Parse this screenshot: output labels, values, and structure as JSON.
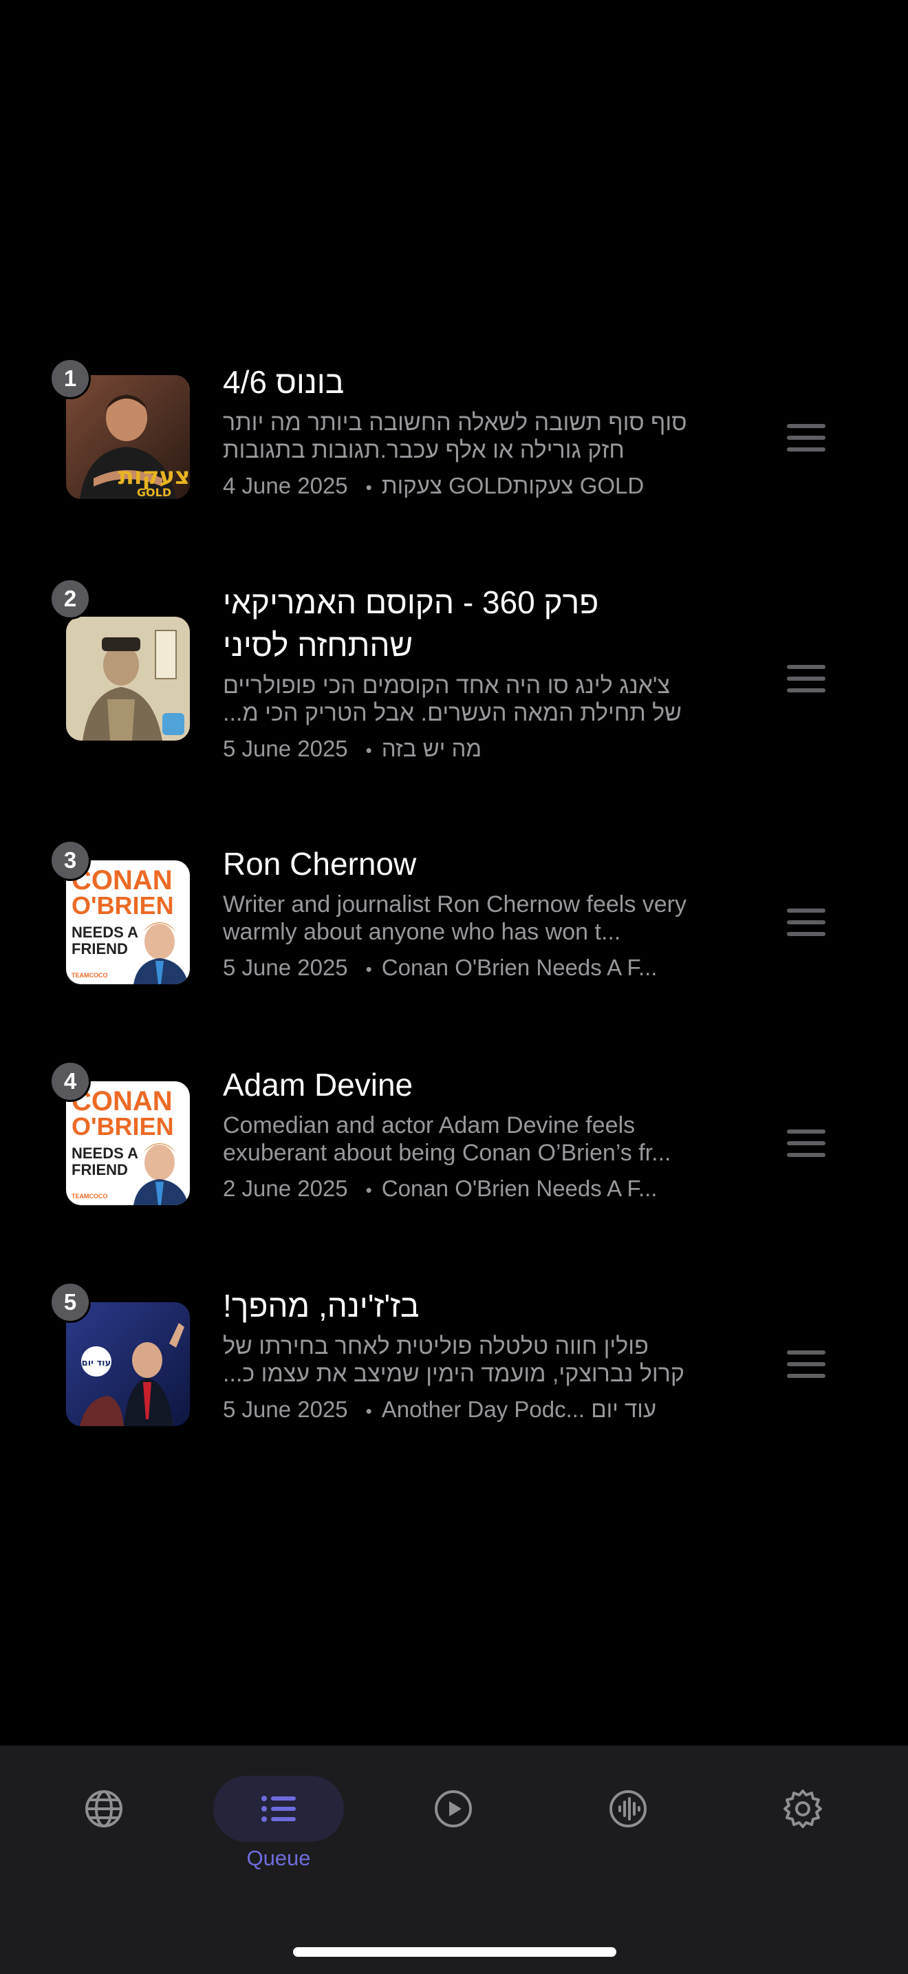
{
  "queue": {
    "items": [
      {
        "number": "1",
        "title": "בונוס 4/6",
        "description": "סוף סוף תשובה לשאלה החשובה ביותר מה יותר חזק גורילה או אלף עכבר.תגובות בתגובות",
        "date": "4 June 2025",
        "podcast": "צעקות GOLDצעקות GOLD",
        "artwork": "tzaakot-gold-artwork"
      },
      {
        "number": "2",
        "title": "פרק 360 - הקוסם האמריקאי שהתחזה לסיני",
        "description": "צ'אנג לינג סו היה אחד הקוסמים הכי פופולריים של תחילת המאה העשרים. אבל הטריק הכי מ...",
        "date": "5 June 2025",
        "podcast": "מה יש בזה",
        "artwork": "ma-yesh-baze-artwork"
      },
      {
        "number": "3",
        "title": "Ron Chernow",
        "description": "Writer and journalist Ron Chernow feels very warmly about anyone who has won t...",
        "date": "5 June 2025",
        "podcast": "Conan O'Brien Needs A F...",
        "artwork": "conan-artwork"
      },
      {
        "number": "4",
        "title": "Adam Devine",
        "description": "Comedian and actor Adam Devine feels exuberant about being Conan O’Brien’s fr...",
        "date": "2 June 2025",
        "podcast": "Conan O'Brien Needs A F...",
        "artwork": "conan-artwork"
      },
      {
        "number": "5",
        "title": "בז'ז'ינה, מהפך!",
        "description": "פולין חווה טלטלה פוליטית לאחר בחירתו של קרול נברוצקי, מועמד הימין שמיצב את עצמו כ...",
        "date": "5 June 2025",
        "podcast": "Another Day Podc... עוד יום",
        "artwork": "od-yom-artwork"
      }
    ]
  },
  "conan_art": {
    "line1": "CONAN",
    "line2": "O'BRIEN",
    "line3": "NEEDS A",
    "line4": "FRIEND",
    "brand": "TEAMCOCO"
  },
  "gold_art": {
    "text": "צעקות",
    "gold": "GOLD"
  },
  "od_yom_art": {
    "text": "עוד יום"
  },
  "tab_bar": {
    "tabs": [
      {
        "icon": "globe-icon",
        "label": ""
      },
      {
        "icon": "list-icon",
        "label": "Queue",
        "active": true
      },
      {
        "icon": "play-circle-icon",
        "label": ""
      },
      {
        "icon": "waveform-icon",
        "label": ""
      },
      {
        "icon": "gear-icon",
        "label": ""
      }
    ]
  },
  "colors": {
    "background": "#000000",
    "tab_bar": "#1c1c1e",
    "accent": "#6e6cdc",
    "secondary_text": "#98989d"
  }
}
